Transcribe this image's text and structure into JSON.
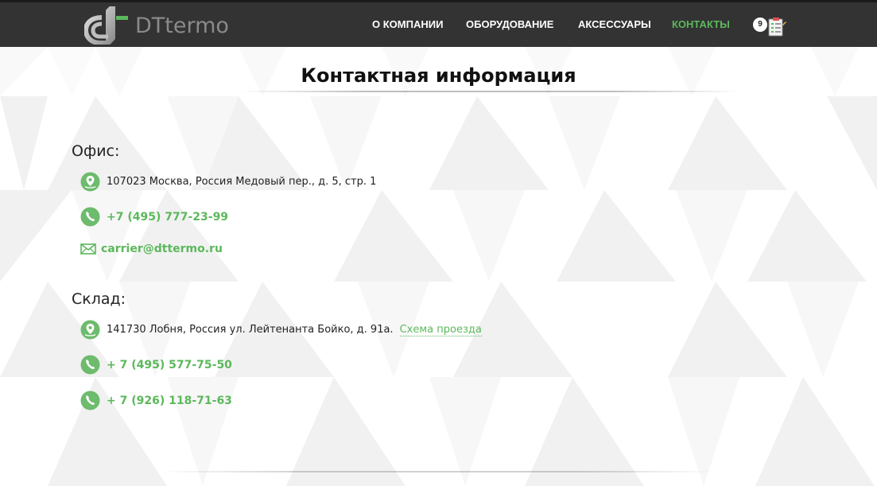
{
  "header": {
    "logo_text": "DTtermo",
    "nav": [
      {
        "label": "О КОМПАНИИ"
      },
      {
        "label": "ОБОРУДОВАНИЕ"
      },
      {
        "label": "АКСЕССУАРЫ"
      },
      {
        "label": "КОНТАКТЫ",
        "active": true
      }
    ],
    "cart_count": "9"
  },
  "page": {
    "title": "Контактная информация"
  },
  "office": {
    "heading": "Офис:",
    "address": "107023 Москва, Россия Медовый пер., д. 5, стр. 1",
    "phone": "+7 (495) 777-23-99",
    "email": "carrier@dttermo.ru"
  },
  "warehouse": {
    "heading": "Склад:",
    "address": "141730 Лобня, Россия ул. Лейтенанта Бойко, д. 91а.",
    "map_link": "Схема проезда",
    "phone1": "+ 7 (495) 577-75-50",
    "phone2": "+ 7 (926) 118-71-63"
  },
  "colors": {
    "accent": "#5cb85c",
    "header_bg": "#333333",
    "text": "#222222"
  }
}
